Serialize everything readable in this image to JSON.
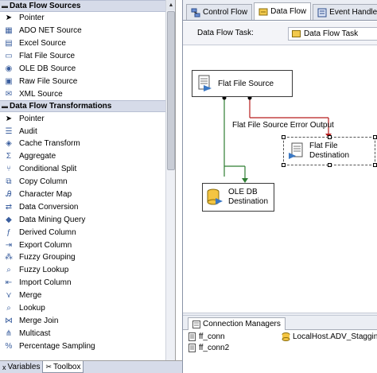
{
  "toolbox": {
    "sections": [
      {
        "title": "Data Flow Sources",
        "items": [
          {
            "label": "Pointer",
            "icon": "pointer-icon"
          },
          {
            "label": "ADO NET Source",
            "icon": "ado-net-source-icon"
          },
          {
            "label": "Excel Source",
            "icon": "excel-source-icon"
          },
          {
            "label": "Flat File Source",
            "icon": "flat-file-source-icon"
          },
          {
            "label": "OLE DB Source",
            "icon": "ole-db-source-icon"
          },
          {
            "label": "Raw File Source",
            "icon": "raw-file-source-icon"
          },
          {
            "label": "XML Source",
            "icon": "xml-source-icon"
          }
        ]
      },
      {
        "title": "Data Flow Transformations",
        "items": [
          {
            "label": "Pointer",
            "icon": "pointer-icon"
          },
          {
            "label": "Audit",
            "icon": "audit-icon"
          },
          {
            "label": "Cache Transform",
            "icon": "cache-transform-icon"
          },
          {
            "label": "Aggregate",
            "icon": "aggregate-icon"
          },
          {
            "label": "Conditional Split",
            "icon": "conditional-split-icon"
          },
          {
            "label": "Copy Column",
            "icon": "copy-column-icon"
          },
          {
            "label": "Character Map",
            "icon": "character-map-icon"
          },
          {
            "label": "Data Conversion",
            "icon": "data-conversion-icon"
          },
          {
            "label": "Data Mining Query",
            "icon": "data-mining-query-icon"
          },
          {
            "label": "Derived Column",
            "icon": "derived-column-icon"
          },
          {
            "label": "Export Column",
            "icon": "export-column-icon"
          },
          {
            "label": "Fuzzy Grouping",
            "icon": "fuzzy-grouping-icon"
          },
          {
            "label": "Fuzzy Lookup",
            "icon": "fuzzy-lookup-icon"
          },
          {
            "label": "Import Column",
            "icon": "import-column-icon"
          },
          {
            "label": "Merge",
            "icon": "merge-icon"
          },
          {
            "label": "Lookup",
            "icon": "lookup-icon"
          },
          {
            "label": "Merge Join",
            "icon": "merge-join-icon"
          },
          {
            "label": "Multicast",
            "icon": "multicast-icon"
          },
          {
            "label": "Percentage Sampling",
            "icon": "percentage-sampling-icon"
          }
        ]
      }
    ]
  },
  "bottom_tabs": {
    "variables": "Variables",
    "toolbox": "Toolbox"
  },
  "doc_tabs": {
    "control_flow": "Control Flow",
    "data_flow": "Data Flow",
    "event_handlers": "Event Handlers"
  },
  "task_row": {
    "label": "Data Flow Task:",
    "selected": "Data Flow Task"
  },
  "canvas": {
    "flat_file_source": "Flat File Source",
    "ole_db_destination": [
      "OLE DB",
      "Destination"
    ],
    "flat_file_destination": [
      "Flat File",
      "Destination"
    ],
    "error_output_label": "Flat File Source Error Output"
  },
  "connections": {
    "tab_label": "Connection Managers",
    "items": [
      "ff_conn",
      "ff_conn2",
      "LocalHost.ADV_Stagging"
    ]
  },
  "colors": {
    "success_path": "#2e7d32",
    "error_path": "#b71c1c",
    "section_header": "#d6dbe9"
  }
}
